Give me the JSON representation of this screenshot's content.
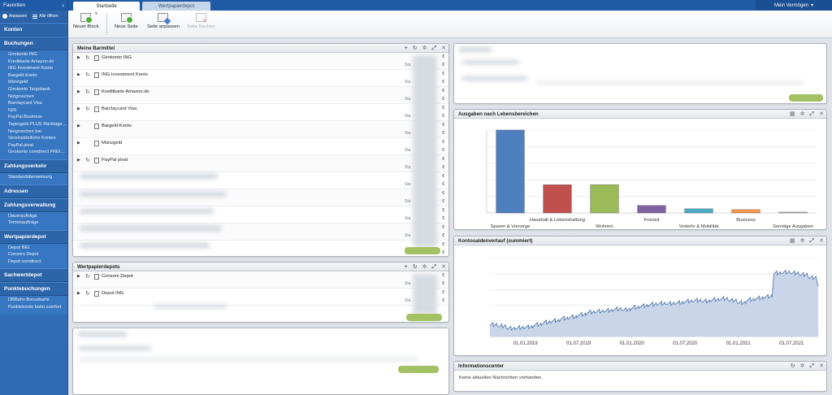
{
  "sidebar": {
    "favorites_label": "Favoriten",
    "tools": {
      "adjust_label": "Anpassen",
      "open_all_label": "Alle öffnen"
    },
    "sections": [
      {
        "title": "Konten",
        "items": []
      },
      {
        "title": "Buchungen",
        "items": [
          "Girokonto ING",
          "Kreditkarte Amazon.de",
          "ING Investment Konto",
          "Bargeld-Konto",
          "Münzgeld",
          "Girokonto Targobank",
          "Notgroschen",
          "Barclaycard Visa",
          "N26",
          "PayPal Business",
          "Tagesgeld PLUS Rücklage…",
          "Notgroschen bar",
          "Vereinsähnliche Konten",
          "PayPal pivat",
          "Girokonto comdirect FREI…"
        ]
      },
      {
        "title": "Zahlungsverkehr",
        "items": [
          "Standardüberweisung"
        ]
      },
      {
        "title": "Adressen",
        "items": []
      },
      {
        "title": "Zahlungsverwaltung",
        "items": [
          "Daueraufträge",
          "Terminaufträge"
        ]
      },
      {
        "title": "Wertpapierdepot",
        "items": [
          "Depot ING",
          "Consors Depot",
          "Depot comdirect"
        ]
      },
      {
        "title": "Sachwertdepot",
        "items": []
      },
      {
        "title": "Punktebuchungen",
        "items": [
          "DBBahn Bonuskarte",
          "Punktekonto bahn.comfort"
        ]
      }
    ]
  },
  "topbar": {
    "tabs": [
      "Startseite",
      "Wertpapierdepot"
    ],
    "vermoegen_label": "Mein Vermögen"
  },
  "toolbar": {
    "new_block": "Neuer Block",
    "new_page": "Neue Seite",
    "adjust_page": "Seite anpassen",
    "delete_page": "Seite löschen"
  },
  "barmittel": {
    "title": "Meine Barmittel",
    "accounts": [
      {
        "name": "Girokonto ING",
        "refresh": true
      },
      {
        "name": "ING Investment Konto",
        "refresh": true
      },
      {
        "name": "Kreditkarte Amazon.de",
        "refresh": true
      },
      {
        "name": "Barclaycard Visa",
        "refresh": true
      },
      {
        "name": "Bargeld-Konto",
        "refresh": false
      },
      {
        "name": "Münzgeld",
        "refresh": false
      },
      {
        "name": "PayPal pivat",
        "refresh": true
      }
    ],
    "stand_label": "Sta",
    "currency": "€"
  },
  "depots": {
    "title": "Wertpapierdepots",
    "items": [
      "Consors Depot",
      "Depot ING"
    ]
  },
  "ausgaben": {
    "title": "Ausgaben nach Lebensbereichen"
  },
  "kontosalden": {
    "title": "Kontosaldenverlauf (summiert)"
  },
  "info": {
    "title": "Informationscenter",
    "message": "Keine aktuellen Nachrichten vorhanden."
  },
  "chart_data": [
    {
      "type": "bar",
      "title": "Ausgaben nach Lebensbereichen",
      "categories": [
        "Sparen & Vorsorge",
        "Haushalt & Lebenshaltung",
        "Wohnen",
        "Freizeit",
        "Verkehr & Mobilität",
        "Business",
        "Sonstige Ausgaben"
      ],
      "values": [
        100,
        34,
        34,
        9,
        5,
        4,
        1
      ],
      "colors": [
        "#4f7fbf",
        "#c0504d",
        "#9bbb59",
        "#8064a2",
        "#4bacc6",
        "#f79646",
        "#c0c0c0"
      ],
      "ylim": [
        0,
        100
      ],
      "grid": true
    },
    {
      "type": "area",
      "title": "Kontosaldenverlauf (summiert)",
      "x_ticks": [
        "01.01.2019",
        "01.07.2019",
        "01.01.2020",
        "01.07.2020",
        "01.01.2021",
        "01.07.2021"
      ],
      "x": [
        "2018-09",
        "2018-10",
        "2018-11",
        "2018-12",
        "2019-01",
        "2019-02",
        "2019-03",
        "2019-04",
        "2019-05",
        "2019-06",
        "2019-07",
        "2019-08",
        "2019-09",
        "2019-10",
        "2019-11",
        "2019-12",
        "2020-01",
        "2020-02",
        "2020-03",
        "2020-04",
        "2020-05",
        "2020-06",
        "2020-07",
        "2020-08",
        "2020-09",
        "2020-10",
        "2020-11",
        "2020-12",
        "2021-01",
        "2021-02",
        "2021-03",
        "2021-04",
        "2021-05",
        "2021-06",
        "2021-07",
        "2021-08",
        "2021-09",
        "2021-10"
      ],
      "values": [
        14,
        12,
        9,
        10,
        11,
        14,
        17,
        19,
        22,
        24,
        27,
        30,
        31,
        32,
        34,
        33,
        36,
        38,
        40,
        41,
        41,
        42,
        44,
        45,
        44,
        46,
        47,
        45,
        42,
        46,
        48,
        50,
        80,
        81,
        80,
        78,
        74,
        64
      ],
      "ylim": [
        0,
        100
      ],
      "grid": true
    }
  ]
}
